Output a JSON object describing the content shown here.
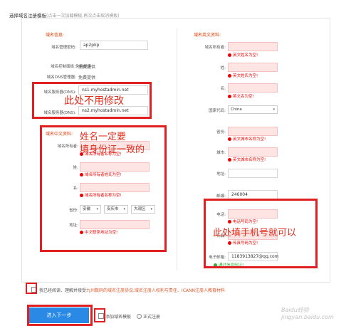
{
  "page_title": "选择域名注册模板",
  "page_title_hint": "(点击一次加载模板,再次点击取消模板)",
  "left": {
    "section_info": "域名信息:",
    "mgmt_password_label": "域名管理密码:",
    "mgmt_password_value": "ap2pkp",
    "control_panel_label": "域名控制面板:",
    "control_panel_value": "免费提供",
    "dns_manager_label": "域名DNS管理器:",
    "dns_manager_value": "免费提供",
    "dns1_label": "域名服务器(DNS):",
    "dns1_value": "ns1.myhostadmin.net",
    "dns2_label": "域名服务器(DNS):",
    "dns2_value": "ns2.myhostadmin.net",
    "section_cn": "域名中文资料:",
    "owner_label": "域名所有者:",
    "owner_error": "域名所有者名称为空!",
    "surname_label": "姓:",
    "surname_error": "域名所有者姓氏为空!",
    "given_label": "名:",
    "given_error": "域名所有者名称为空!",
    "region_label": "省份:",
    "province": "安徽",
    "city": "安庆市",
    "district": "大观区",
    "address_label": "地址:",
    "address_error": "中文联系地址为空!"
  },
  "right": {
    "section_en": "域名英文资料:",
    "owner_label": "域名所有者:",
    "owner_error": "英文姓名为空!",
    "surname_label": "姓:",
    "surname_error": "英文姓氏为空!",
    "given_label": "名:",
    "given_error": "英文名为空!",
    "country_label": "国家代码:",
    "country_value": "China",
    "province_label": "省份:",
    "province_error": "英文城市名称为空!",
    "city_label": "城市:",
    "city_error": "英文城市名称为空!",
    "address_label": "地址:",
    "postcode_label": "邮编:",
    "postcode_value": "246004",
    "phone_label": "电话:",
    "phone_error": "电话号码为空!",
    "fax_label": "传真:",
    "fax_error": "传真号码为空!",
    "email_label": "电子邮箱:",
    "email_value": "1183913827@qq.com",
    "email_ok": "通过信息验证!"
  },
  "annotations": {
    "no_change": "此处不用修改",
    "name_line1": "姓名一定要",
    "name_line2": "填身份证一致的",
    "phone": "此处填手机号就可以"
  },
  "footer": {
    "agree_prefix": "我已经阅读、理解并接受",
    "agree_link": "九州数码的域名注册协议,域名注册人权利与责任、ICANN注册人教育材料",
    "next_button": "进入下一步",
    "add_template": "添加域名模板",
    "formal_register": "正式注册"
  },
  "watermark": "Baidu经验 jingyan.baidu.com"
}
